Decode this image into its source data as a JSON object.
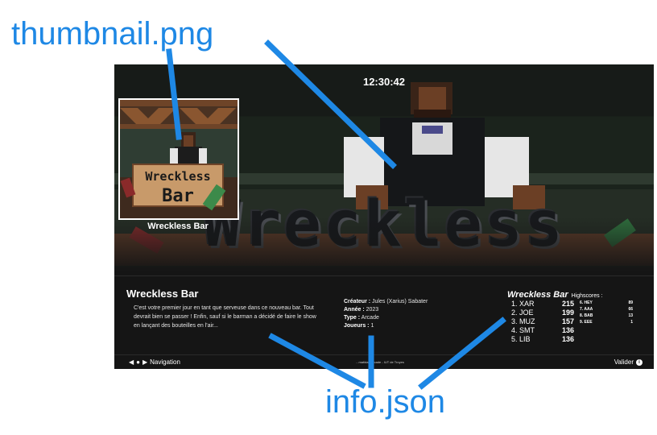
{
  "annotations": {
    "thumbnail_label": "thumbnail.png",
    "info_label": "info.json",
    "color": "#1e88e5"
  },
  "app": {
    "clock": "12:30:42",
    "hero_title": "Wreckless",
    "thumbnail": {
      "logo_line1": "Wreckless",
      "logo_line2": "Bar",
      "caption": "Wreckless Bar"
    },
    "game": {
      "title": "Wreckless Bar",
      "description": "C'est votre premier jour en tant que serveuse dans ce nouveau bar. Tout devrait bien se passer ! Enfin, sauf si le barman a décidé de faire le show en lançant des bouteilles en l'air...",
      "creator_label": "Créateur :",
      "creator": "Jules (Xarius) Sabater",
      "year_label": "Année :",
      "year": "2023",
      "type_label": "Type :",
      "type": "Arcade",
      "players_label": "Joueurs :",
      "players": "1"
    },
    "highscores": {
      "game_name": "Wreckless Bar",
      "label": "Highscores :",
      "top": [
        {
          "rank": "1. XAR",
          "score": "215"
        },
        {
          "rank": "2. JOE",
          "score": "199"
        },
        {
          "rank": "3. MUZ",
          "score": "157"
        },
        {
          "rank": "4. SMT",
          "score": "136"
        },
        {
          "rank": "5. LIB",
          "score": "136"
        }
      ],
      "others": [
        {
          "rank": "6. HEY",
          "score": "89"
        },
        {
          "rank": "7. AAA",
          "score": "66"
        },
        {
          "rank": "8. BAB",
          "score": "13"
        },
        {
          "rank": "9. EEE",
          "score": "1"
        }
      ]
    },
    "footer": {
      "nav_label": "Navigation",
      "credit": "...matidae Arcade - IUT de Troyes",
      "validate_label": "Valider",
      "icons": [
        "arrow-left-icon",
        "user-icon",
        "arrow-right-icon",
        "button-icon"
      ]
    }
  }
}
